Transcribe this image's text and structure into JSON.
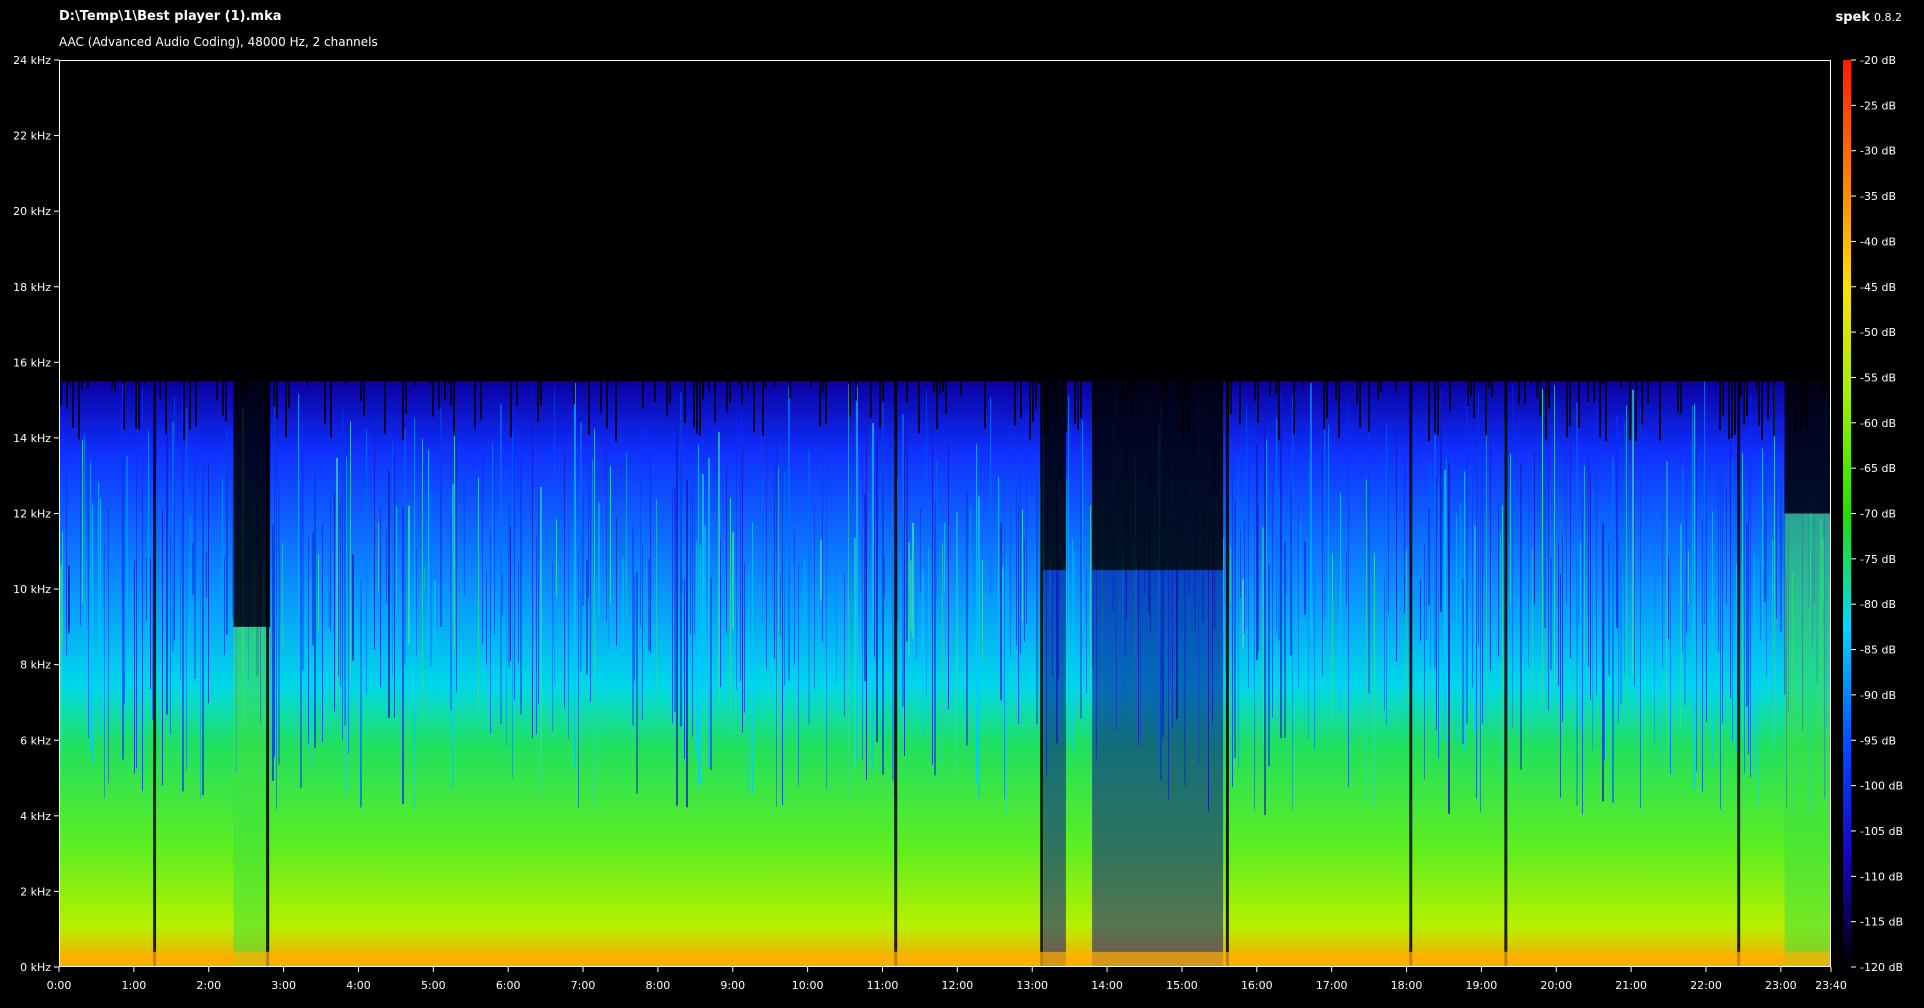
{
  "header": {
    "file_path": "D:\\Temp\\1\\Best player (1).mka",
    "codec_info": "AAC (Advanced Audio Coding), 48000 Hz, 2 channels",
    "app_name": "spek",
    "app_version": "0.8.2"
  },
  "chart_data": {
    "type": "heatmap",
    "title": "",
    "xlabel": "",
    "ylabel": "",
    "x_unit": "minutes",
    "xlim": [
      0,
      23.67
    ],
    "x_ticks": [
      {
        "value": 0,
        "label": "0:00"
      },
      {
        "value": 1,
        "label": "1:00"
      },
      {
        "value": 2,
        "label": "2:00"
      },
      {
        "value": 3,
        "label": "3:00"
      },
      {
        "value": 4,
        "label": "4:00"
      },
      {
        "value": 5,
        "label": "5:00"
      },
      {
        "value": 6,
        "label": "6:00"
      },
      {
        "value": 7,
        "label": "7:00"
      },
      {
        "value": 8,
        "label": "8:00"
      },
      {
        "value": 9,
        "label": "9:00"
      },
      {
        "value": 10,
        "label": "10:00"
      },
      {
        "value": 11,
        "label": "11:00"
      },
      {
        "value": 12,
        "label": "12:00"
      },
      {
        "value": 13,
        "label": "13:00"
      },
      {
        "value": 14,
        "label": "14:00"
      },
      {
        "value": 15,
        "label": "15:00"
      },
      {
        "value": 16,
        "label": "16:00"
      },
      {
        "value": 17,
        "label": "17:00"
      },
      {
        "value": 18,
        "label": "18:00"
      },
      {
        "value": 19,
        "label": "19:00"
      },
      {
        "value": 20,
        "label": "20:00"
      },
      {
        "value": 21,
        "label": "21:00"
      },
      {
        "value": 22,
        "label": "22:00"
      },
      {
        "value": 23,
        "label": "23:00"
      },
      {
        "value": 23.67,
        "label": "23:40"
      }
    ],
    "y_unit": "kHz",
    "ylim": [
      0,
      24
    ],
    "y_ticks": [
      {
        "value": 0,
        "label": "0 kHz"
      },
      {
        "value": 2,
        "label": "2 kHz"
      },
      {
        "value": 4,
        "label": "4 kHz"
      },
      {
        "value": 6,
        "label": "6 kHz"
      },
      {
        "value": 8,
        "label": "8 kHz"
      },
      {
        "value": 10,
        "label": "10 kHz"
      },
      {
        "value": 12,
        "label": "12 kHz"
      },
      {
        "value": 14,
        "label": "14 kHz"
      },
      {
        "value": 16,
        "label": "16 kHz"
      },
      {
        "value": 18,
        "label": "18 kHz"
      },
      {
        "value": 20,
        "label": "20 kHz"
      },
      {
        "value": 22,
        "label": "22 kHz"
      },
      {
        "value": 24,
        "label": "24 kHz"
      }
    ],
    "colorbar": {
      "unit": "dB",
      "range": [
        -120,
        -20
      ],
      "ticks": [
        {
          "value": -20,
          "label": "-20 dB"
        },
        {
          "value": -25,
          "label": "-25 dB"
        },
        {
          "value": -30,
          "label": "-30 dB"
        },
        {
          "value": -35,
          "label": "-35 dB"
        },
        {
          "value": -40,
          "label": "-40 dB"
        },
        {
          "value": -45,
          "label": "-45 dB"
        },
        {
          "value": -50,
          "label": "-50 dB"
        },
        {
          "value": -55,
          "label": "-55 dB"
        },
        {
          "value": -60,
          "label": "-60 dB"
        },
        {
          "value": -65,
          "label": "-65 dB"
        },
        {
          "value": -70,
          "label": "-70 dB"
        },
        {
          "value": -75,
          "label": "-75 dB"
        },
        {
          "value": -80,
          "label": "-80 dB"
        },
        {
          "value": -85,
          "label": "-85 dB"
        },
        {
          "value": -90,
          "label": "-90 dB"
        },
        {
          "value": -95,
          "label": "-95 dB"
        },
        {
          "value": -100,
          "label": "-100 dB"
        },
        {
          "value": -105,
          "label": "-105 dB"
        },
        {
          "value": -110,
          "label": "-110 dB"
        },
        {
          "value": -115,
          "label": "-115 dB"
        },
        {
          "value": -120,
          "label": "-120 dB"
        }
      ],
      "colors": [
        "#ff1a00",
        "#ff7a00",
        "#ffe000",
        "#9cf000",
        "#20e000",
        "#00d8ff",
        "#0050ff",
        "#1a00c8",
        "#000000"
      ]
    },
    "spectral_cutoff_khz": 15.5,
    "low_band_cutoff_khz": 10.5,
    "quiet_segments": [
      {
        "start_min": 2.33,
        "end_min": 2.82,
        "max_khz": 9,
        "note_level_db": -65
      },
      {
        "start_min": 13.15,
        "end_min": 13.45,
        "max_khz": 10.5,
        "note_level_db": -100
      },
      {
        "start_min": 13.8,
        "end_min": 15.55,
        "max_khz": 10.5,
        "note_level_db": -95
      },
      {
        "start_min": 23.05,
        "end_min": 23.67,
        "max_khz": 12,
        "note_level_db": -85
      }
    ],
    "silence_gaps_min": [
      1.27,
      2.78,
      11.17,
      13.12,
      15.6,
      18.05,
      19.32,
      22.43
    ]
  }
}
